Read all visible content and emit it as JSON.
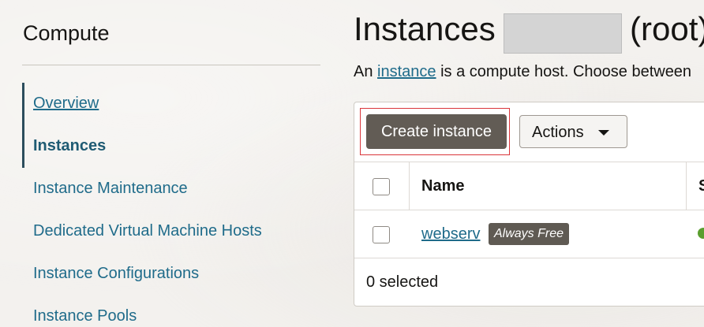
{
  "sidebar": {
    "title": "Compute",
    "items": [
      {
        "label": "Overview"
      },
      {
        "label": "Instances"
      },
      {
        "label": "Instance Maintenance"
      },
      {
        "label": "Dedicated Virtual Machine Hosts"
      },
      {
        "label": "Instance Configurations"
      },
      {
        "label": "Instance Pools"
      }
    ]
  },
  "header": {
    "title": "Instances",
    "title_suffix": "(root)",
    "description_prefix": "An ",
    "description_link": "instance",
    "description_suffix": " is a compute host. Choose between"
  },
  "toolbar": {
    "create_label": "Create instance",
    "actions_label": "Actions",
    "actions_icon": "caret-down-icon"
  },
  "table": {
    "columns": [
      "Name",
      "S"
    ],
    "rows": [
      {
        "name": "webserv",
        "badge": "Always Free",
        "state_color": "#5a9e2f"
      }
    ]
  },
  "footer": {
    "selected_text": "0 selected"
  },
  "colors": {
    "link": "#1f6b8a",
    "primary_button": "#625c55",
    "highlight_outline": "#d9353a",
    "status_running": "#5a9e2f"
  }
}
